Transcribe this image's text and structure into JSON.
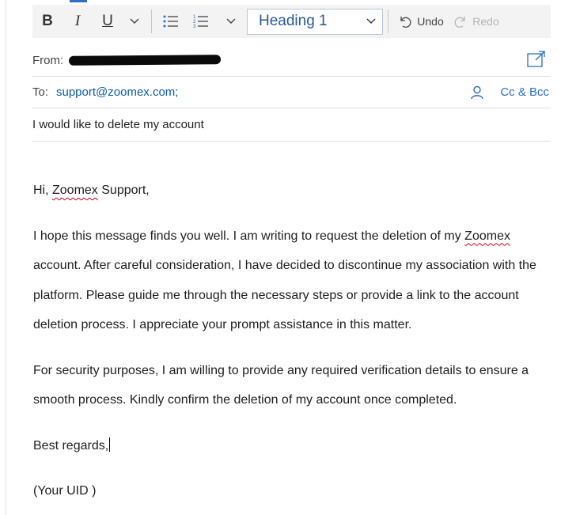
{
  "toolbar": {
    "bold_label": "B",
    "italic_label": "I",
    "underline_label": "U",
    "style_value": "Heading 1",
    "undo_label": "Undo",
    "redo_label": "Redo"
  },
  "header": {
    "from_label": "From:",
    "to_label": "To:",
    "to_value": "support@zoomex.com;",
    "cc_bcc_label": "Cc & Bcc",
    "subject": "I would like to delete my account"
  },
  "body": {
    "greeting_pre": "Hi, ",
    "greeting_name": "Zoomex",
    "greeting_post": " Support,",
    "p1_pre": "I hope this message finds you well. I am writing to request the deletion of my ",
    "p1_name": "Zoomex",
    "p1_post": " account. After careful consideration, I have decided to discontinue my association with the platform. Please guide me through the necessary steps or provide a link to the account deletion process. I appreciate your prompt assistance in this matter.",
    "p2": "For security purposes, I am willing to provide any required verification details to ensure a smooth process. Kindly confirm the deletion of my account once completed.",
    "closing": "Best regards,",
    "signature": "(Your UID )"
  },
  "colors": {
    "accent": "#2b6cc4",
    "link": "#0b5bb0",
    "style_text": "#2b579a",
    "spell_error": "#d0021b"
  },
  "icons": [
    "bold-icon",
    "italic-icon",
    "underline-icon",
    "chevron-down-icon",
    "bullet-list-icon",
    "numbered-list-icon",
    "undo-icon",
    "redo-icon",
    "popout-icon",
    "person-icon"
  ]
}
